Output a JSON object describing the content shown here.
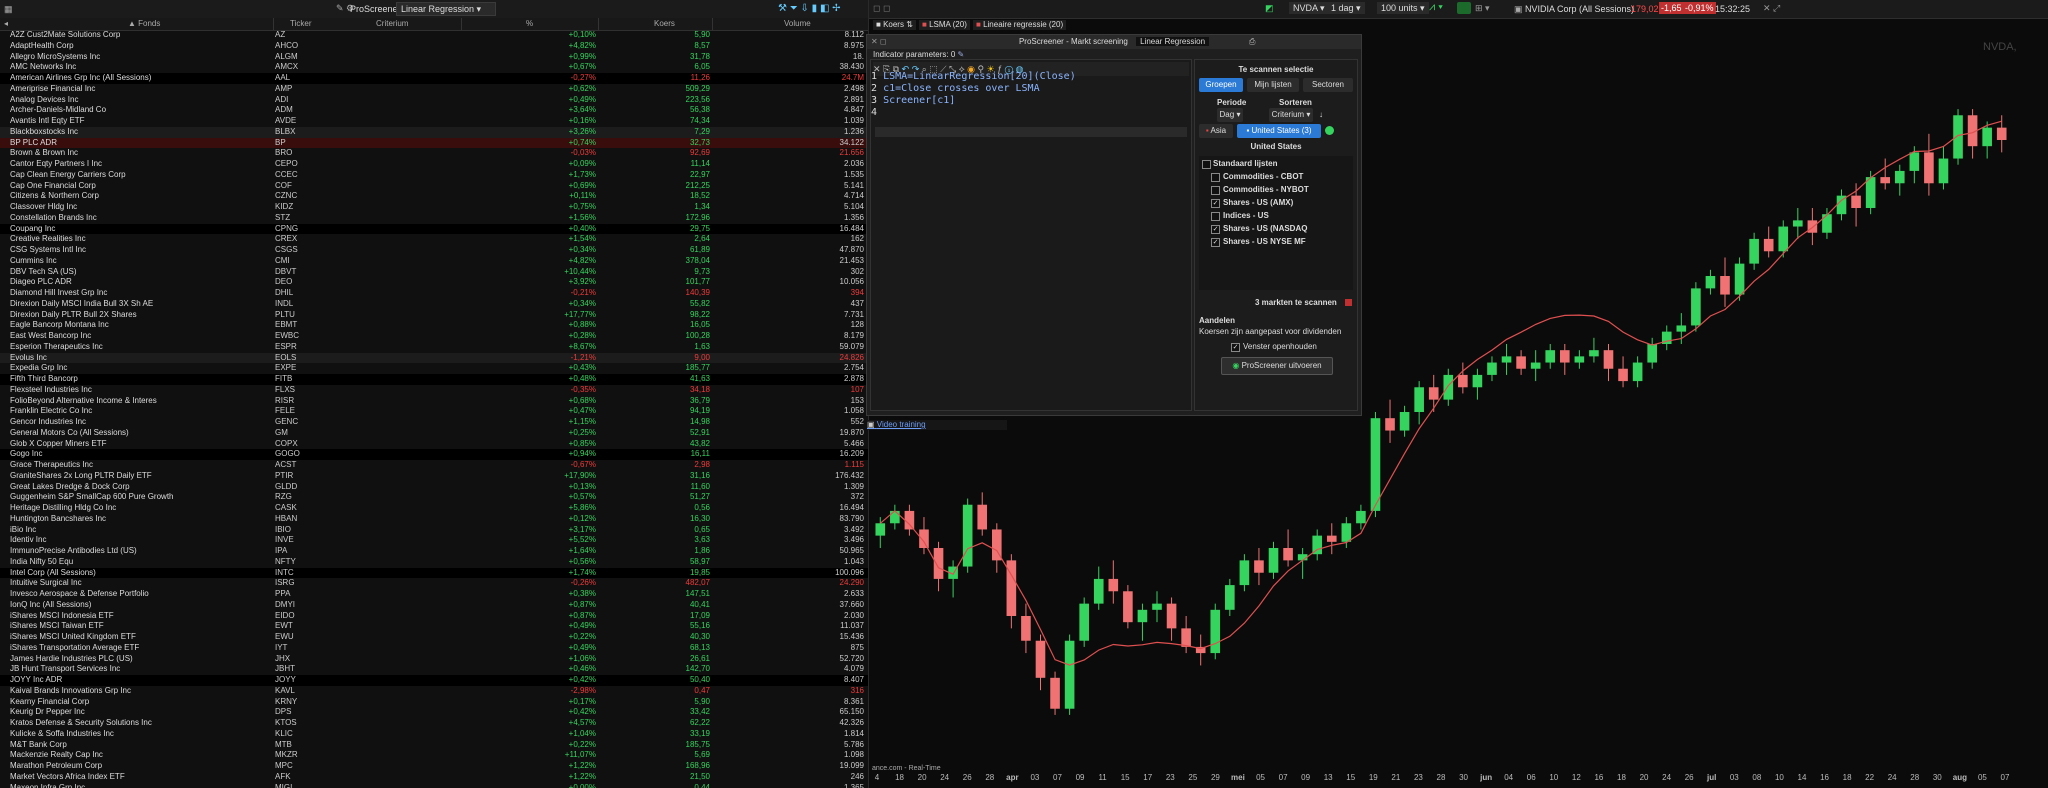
{
  "left_toolbar": {
    "title": "ProScreener",
    "dropdown": "Linear Regression"
  },
  "columns": {
    "name": "Fonds",
    "ticker": "Ticker",
    "criterium": "Criterium",
    "pct": "%",
    "price": "Koers",
    "volume": "Volume"
  },
  "rows": [
    {
      "name": "A2Z Cust2Mate Solutions Corp",
      "ticker": "AZ",
      "pct": "+0,10%",
      "price": "5,90",
      "vol": "8.112",
      "bg": ""
    },
    {
      "name": "AdaptHealth Corp",
      "ticker": "AHCO",
      "pct": "+4,82%",
      "price": "8,57",
      "vol": "8.975",
      "bg": ""
    },
    {
      "name": "Allegro MicroSystems Inc",
      "ticker": "ALGM",
      "pct": "+0,99%",
      "price": "31,78",
      "vol": "18.",
      "bg": ""
    },
    {
      "name": "AMC Networks Inc",
      "ticker": "AMCX",
      "pct": "+0,67%",
      "price": "6,05",
      "vol": "38.430",
      "bg": ""
    },
    {
      "name": "American Airlines Grp Inc (All Sessions)",
      "ticker": "AAL",
      "pct": "-0,27%",
      "price": "11,26",
      "vol": "24.7M",
      "bg": "black"
    },
    {
      "name": "Ameriprise Financial Inc",
      "ticker": "AMP",
      "pct": "+0,62%",
      "price": "509,29",
      "vol": "2.498",
      "bg": ""
    },
    {
      "name": "Analog Devices Inc",
      "ticker": "ADI",
      "pct": "+0,49%",
      "price": "223,56",
      "vol": "2.891",
      "bg": ""
    },
    {
      "name": "Archer-Daniels-Midland Co",
      "ticker": "ADM",
      "pct": "+3,64%",
      "price": "56,38",
      "vol": "4.847",
      "bg": ""
    },
    {
      "name": "Avantis Intl Eqty ETF",
      "ticker": "AVDE",
      "pct": "+0,16%",
      "price": "74,34",
      "vol": "1.039",
      "bg": ""
    },
    {
      "name": "Blackboxstocks Inc",
      "ticker": "BLBX",
      "pct": "+3,26%",
      "price": "7,29",
      "vol": "1.236",
      "bg": "dark"
    },
    {
      "name": "BP PLC ADR",
      "ticker": "BP",
      "pct": "+0,74%",
      "price": "32,73",
      "vol": "34.122",
      "bg": "red"
    },
    {
      "name": "Brown & Brown Inc",
      "ticker": "BRO",
      "pct": "-0,03%",
      "price": "92,69",
      "vol": "21.656",
      "bg": ""
    },
    {
      "name": "Cantor Eqty Partners I Inc",
      "ticker": "CEPO",
      "pct": "+0,09%",
      "price": "11,14",
      "vol": "2.036",
      "bg": ""
    },
    {
      "name": "Cap Clean Energy Carriers Corp",
      "ticker": "CCEC",
      "pct": "+1,73%",
      "price": "22,97",
      "vol": "1.535",
      "bg": ""
    },
    {
      "name": "Cap One Financial Corp",
      "ticker": "COF",
      "pct": "+0,69%",
      "price": "212,25",
      "vol": "5.141",
      "bg": ""
    },
    {
      "name": "Citizens & Northern Corp",
      "ticker": "CZNC",
      "pct": "+0,11%",
      "price": "18,52",
      "vol": "4.714",
      "bg": ""
    },
    {
      "name": "Classover Hldg Inc",
      "ticker": "KIDZ",
      "pct": "+0,75%",
      "price": "1,34",
      "vol": "5.104",
      "bg": ""
    },
    {
      "name": "Constellation Brands Inc",
      "ticker": "STZ",
      "pct": "+1,56%",
      "price": "172,96",
      "vol": "1.356",
      "bg": ""
    },
    {
      "name": "Coupang Inc",
      "ticker": "CPNG",
      "pct": "+0,40%",
      "price": "29,75",
      "vol": "16.484",
      "bg": "black"
    },
    {
      "name": "Creative Realities Inc",
      "ticker": "CREX",
      "pct": "+1,54%",
      "price": "2,64",
      "vol": "162",
      "bg": ""
    },
    {
      "name": "CSG Systems Intl Inc",
      "ticker": "CSGS",
      "pct": "+0,34%",
      "price": "61,89",
      "vol": "47.870",
      "bg": ""
    },
    {
      "name": "Cummins Inc",
      "ticker": "CMI",
      "pct": "+4,82%",
      "price": "378,04",
      "vol": "21.453",
      "bg": ""
    },
    {
      "name": "DBV Tech SA (US)",
      "ticker": "DBVT",
      "pct": "+10,44%",
      "price": "9,73",
      "vol": "302",
      "bg": ""
    },
    {
      "name": "Diageo PLC ADR",
      "ticker": "DEO",
      "pct": "+3,92%",
      "price": "101,77",
      "vol": "10.056",
      "bg": ""
    },
    {
      "name": "Diamond Hill Invest Grp Inc",
      "ticker": "DHIL",
      "pct": "-0,21%",
      "price": "140,39",
      "vol": "394",
      "bg": ""
    },
    {
      "name": "Direxion Daily MSCI India Bull 3X Sh AE",
      "ticker": "INDL",
      "pct": "+0,34%",
      "price": "55,82",
      "vol": "437",
      "bg": ""
    },
    {
      "name": "Direxion Daily PLTR Bull 2X Shares",
      "ticker": "PLTU",
      "pct": "+17,77%",
      "price": "98,22",
      "vol": "7.731",
      "bg": ""
    },
    {
      "name": "Eagle Bancorp Montana Inc",
      "ticker": "EBMT",
      "pct": "+0,88%",
      "price": "16,05",
      "vol": "128",
      "bg": ""
    },
    {
      "name": "East West Bancorp Inc",
      "ticker": "EWBC",
      "pct": "+0,28%",
      "price": "100,28",
      "vol": "8.179",
      "bg": ""
    },
    {
      "name": "Esperion Therapeutics Inc",
      "ticker": "ESPR",
      "pct": "+8,67%",
      "price": "1,63",
      "vol": "59.079",
      "bg": ""
    },
    {
      "name": "Evolus Inc",
      "ticker": "EOLS",
      "pct": "-1,21%",
      "price": "9,00",
      "vol": "24.826",
      "bg": "dark"
    },
    {
      "name": "Expedia Grp Inc",
      "ticker": "EXPE",
      "pct": "+0,43%",
      "price": "185,77",
      "vol": "2.754",
      "bg": ""
    },
    {
      "name": "Fifth Third Bancorp",
      "ticker": "FITB",
      "pct": "+0,48%",
      "price": "41,63",
      "vol": "2.878",
      "bg": "black"
    },
    {
      "name": "Flexsteel Industries Inc",
      "ticker": "FLXS",
      "pct": "-0,35%",
      "price": "34,18",
      "vol": "107",
      "bg": ""
    },
    {
      "name": "FolioBeyond Alternative Income & Interes",
      "ticker": "RISR",
      "pct": "+0,68%",
      "price": "36,79",
      "vol": "153",
      "bg": ""
    },
    {
      "name": "Franklin Electric Co Inc",
      "ticker": "FELE",
      "pct": "+0,47%",
      "price": "94,19",
      "vol": "1.058",
      "bg": ""
    },
    {
      "name": "Gencor Industries Inc",
      "ticker": "GENC",
      "pct": "+1,15%",
      "price": "14,98",
      "vol": "552",
      "bg": ""
    },
    {
      "name": "General Motors Co (All Sessions)",
      "ticker": "GM",
      "pct": "+0,25%",
      "price": "52,91",
      "vol": "19.870",
      "bg": ""
    },
    {
      "name": "Glob X Copper Miners ETF",
      "ticker": "COPX",
      "pct": "+0,85%",
      "price": "43,82",
      "vol": "5.466",
      "bg": ""
    },
    {
      "name": "Gogo Inc",
      "ticker": "GOGO",
      "pct": "+0,94%",
      "price": "16,11",
      "vol": "16.209",
      "bg": "black"
    },
    {
      "name": "Grace Therapeutics Inc",
      "ticker": "ACST",
      "pct": "-0,67%",
      "price": "2,98",
      "vol": "1.115",
      "bg": ""
    },
    {
      "name": "GraniteShares 2x Long PLTR Daily ETF",
      "ticker": "PTIR",
      "pct": "+17,90%",
      "price": "31,16",
      "vol": "176.432",
      "bg": ""
    },
    {
      "name": "Great Lakes Dredge & Dock Corp",
      "ticker": "GLDD",
      "pct": "+0,13%",
      "price": "11,60",
      "vol": "1.309",
      "bg": ""
    },
    {
      "name": "Guggenheim S&P SmallCap 600 Pure Growth",
      "ticker": "RZG",
      "pct": "+0,57%",
      "price": "51,27",
      "vol": "372",
      "bg": ""
    },
    {
      "name": "Heritage Distilling Hldg Co Inc",
      "ticker": "CASK",
      "pct": "+5,86%",
      "price": "0,56",
      "vol": "16.494",
      "bg": ""
    },
    {
      "name": "Huntington Bancshares Inc",
      "ticker": "HBAN",
      "pct": "+0,12%",
      "price": "16,30",
      "vol": "83.790",
      "bg": ""
    },
    {
      "name": "iBio Inc",
      "ticker": "IBIO",
      "pct": "+3,17%",
      "price": "0,65",
      "vol": "3.492",
      "bg": ""
    },
    {
      "name": "Identiv Inc",
      "ticker": "INVE",
      "pct": "+5,52%",
      "price": "3,63",
      "vol": "3.496",
      "bg": ""
    },
    {
      "name": "ImmunoPrecise Antibodies Ltd (US)",
      "ticker": "IPA",
      "pct": "+1,64%",
      "price": "1,86",
      "vol": "50.965",
      "bg": ""
    },
    {
      "name": "India Nifty 50 Equ",
      "ticker": "NFTY",
      "pct": "+0,56%",
      "price": "58,97",
      "vol": "1.043",
      "bg": ""
    },
    {
      "name": "Intel Corp (All Sessions)",
      "ticker": "INTC",
      "pct": "+1,74%",
      "price": "19,85",
      "vol": "100.096",
      "bg": "black"
    },
    {
      "name": "Intuitive Surgical Inc",
      "ticker": "ISRG",
      "pct": "-0,26%",
      "price": "482,07",
      "vol": "24.290",
      "bg": ""
    },
    {
      "name": "Invesco Aerospace & Defense Portfolio",
      "ticker": "PPA",
      "pct": "+0,38%",
      "price": "147,51",
      "vol": "2.633",
      "bg": ""
    },
    {
      "name": "IonQ Inc (All Sessions)",
      "ticker": "DMYI",
      "pct": "+0,87%",
      "price": "40,41",
      "vol": "37.660",
      "bg": ""
    },
    {
      "name": "iShares MSCI Indonesia ETF",
      "ticker": "EIDO",
      "pct": "+0,87%",
      "price": "17,09",
      "vol": "2.030",
      "bg": ""
    },
    {
      "name": "iShares MSCI Taiwan ETF",
      "ticker": "EWT",
      "pct": "+0,49%",
      "price": "55,16",
      "vol": "11.037",
      "bg": ""
    },
    {
      "name": "iShares MSCI United Kingdom ETF",
      "ticker": "EWU",
      "pct": "+0,22%",
      "price": "40,30",
      "vol": "15.436",
      "bg": ""
    },
    {
      "name": "iShares Transportation Average ETF",
      "ticker": "IYT",
      "pct": "+0,49%",
      "price": "68,13",
      "vol": "875",
      "bg": ""
    },
    {
      "name": "James Hardie Industries PLC (US)",
      "ticker": "JHX",
      "pct": "+1,06%",
      "price": "26,61",
      "vol": "52.720",
      "bg": ""
    },
    {
      "name": "JB Hunt Transport Services Inc",
      "ticker": "JBHT",
      "pct": "+0,46%",
      "price": "142,70",
      "vol": "4.079",
      "bg": ""
    },
    {
      "name": "JOYY Inc ADR",
      "ticker": "JOYY",
      "pct": "+0,42%",
      "price": "50,40",
      "vol": "8.407",
      "bg": "black"
    },
    {
      "name": "Kaival Brands Innovations Grp Inc",
      "ticker": "KAVL",
      "pct": "-2,98%",
      "price": "0,47",
      "vol": "316",
      "bg": ""
    },
    {
      "name": "Kearny Financial Corp",
      "ticker": "KRNY",
      "pct": "+0,17%",
      "price": "5,90",
      "vol": "8.361",
      "bg": ""
    },
    {
      "name": "Keurig Dr Pepper Inc",
      "ticker": "DPS",
      "pct": "+0,42%",
      "price": "33,42",
      "vol": "65.150",
      "bg": ""
    },
    {
      "name": "Kratos Defense & Security Solutions Inc",
      "ticker": "KTOS",
      "pct": "+4,57%",
      "price": "62,22",
      "vol": "42.326",
      "bg": ""
    },
    {
      "name": "Kulicke & Soffa Industries Inc",
      "ticker": "KLIC",
      "pct": "+1,04%",
      "price": "33,19",
      "vol": "1.814",
      "bg": ""
    },
    {
      "name": "M&T Bank Corp",
      "ticker": "MTB",
      "pct": "+0,22%",
      "price": "185,75",
      "vol": "5.786",
      "bg": ""
    },
    {
      "name": "Mackenzie Realty Cap Inc",
      "ticker": "MKZR",
      "pct": "+11,07%",
      "price": "5,69",
      "vol": "1.098",
      "bg": ""
    },
    {
      "name": "Marathon Petroleum Corp",
      "ticker": "MPC",
      "pct": "+1,22%",
      "price": "168,96",
      "vol": "19.099",
      "bg": ""
    },
    {
      "name": "Market Vectors Africa Index ETF",
      "ticker": "AFK",
      "pct": "+1,22%",
      "price": "21,50",
      "vol": "246",
      "bg": ""
    },
    {
      "name": "Maxeon Infra Grn Inc",
      "ticker": "MIGI",
      "pct": "+0,00%",
      "price": "0,44",
      "vol": "1.365",
      "bg": ""
    }
  ],
  "right_toolbar": {
    "symbol": "NVDA",
    "period": "1 dag",
    "units": "100 units",
    "instrument": "NVIDIA Corp (All Sessions)",
    "last": "179,02",
    "change": "-1,65",
    "change_pct": "-0,91%",
    "time": "15:32:25"
  },
  "tabs": [
    "Koers",
    "LSMA (20)",
    "Lineaire regressie (20)"
  ],
  "chart_label": "NVDA, D",
  "dialog": {
    "title": "ProScreener - Markt screening",
    "subtitle": "Linear Regression",
    "indicator_params": "Indicator parameters: 0",
    "code_lines": [
      {
        "n": "1",
        "text": "LSMA=LinearRegression[20](Close)"
      },
      {
        "n": "2",
        "text": "c1=Close crosses over LSMA"
      },
      {
        "n": "3",
        "text": "Screener[c1]"
      },
      {
        "n": "4",
        "text": ""
      }
    ],
    "video_link": "Video training",
    "sel_title": "Te scannen selectie",
    "tab_groups": "Groepen",
    "tab_lists": "Mijn lijsten",
    "tab_sectors": "Sectoren",
    "period_label": "Periode",
    "sort_label": "Sorteren",
    "period_value": "Dag",
    "sort_value": "Criterium",
    "region_asia": "Asia",
    "region_us": "United States (3)",
    "region_header": "United States",
    "standard_lists": "Standaard lijsten",
    "markets": [
      {
        "label": "Commodities - CBOT",
        "checked": false
      },
      {
        "label": "Commodities - NYBOT",
        "checked": false
      },
      {
        "label": "Shares - US (AMX)",
        "checked": true
      },
      {
        "label": "Indices - US",
        "checked": false
      },
      {
        "label": "Shares - US (NASDAQ",
        "checked": true
      },
      {
        "label": "Shares - US NYSE MF",
        "checked": true
      }
    ],
    "markets_count": "3 markten te scannen",
    "shares_title": "Aandelen",
    "shares_note": "Koersen zijn aangepast voor dividenden",
    "keep_open": "Venster openhouden",
    "run_button": "ProScreener uitvoeren"
  },
  "x_axis_labels": [
    "4",
    "18",
    "20",
    "24",
    "26",
    "28",
    "apr",
    "03",
    "07",
    "09",
    "11",
    "15",
    "17",
    "23",
    "25",
    "29",
    "mei",
    "05",
    "07",
    "09",
    "13",
    "15",
    "19",
    "21",
    "23",
    "28",
    "30",
    "jun",
    "04",
    "06",
    "10",
    "12",
    "16",
    "18",
    "20",
    "24",
    "26",
    "jul",
    "03",
    "08",
    "10",
    "14",
    "16",
    "18",
    "22",
    "24",
    "28",
    "30",
    "aug",
    "05",
    "07"
  ],
  "footer_source": "ance.com - Real-Time",
  "colors": {
    "up": "#35d45f",
    "down": "#f07272",
    "lsma": "#e05050"
  },
  "chart_data": {
    "type": "candlestick",
    "title": "NVDA, D",
    "series": [
      {
        "name": "LSMA (20)",
        "type": "line"
      }
    ],
    "ohlc": [
      [
        115,
        118,
        113,
        117
      ],
      [
        117,
        120,
        116,
        119
      ],
      [
        119,
        120,
        115,
        116
      ],
      [
        116,
        118,
        112,
        113
      ],
      [
        113,
        114,
        106,
        108
      ],
      [
        108,
        111,
        105,
        110
      ],
      [
        110,
        121,
        109,
        120
      ],
      [
        120,
        122,
        115,
        116
      ],
      [
        116,
        117,
        109,
        111
      ],
      [
        111,
        112,
        100,
        102
      ],
      [
        102,
        104,
        96,
        98
      ],
      [
        98,
        99,
        90,
        92
      ],
      [
        92,
        93,
        86,
        87
      ],
      [
        87,
        99,
        86,
        98
      ],
      [
        98,
        105,
        97,
        104
      ],
      [
        104,
        110,
        103,
        108
      ],
      [
        108,
        111,
        104,
        106
      ],
      [
        106,
        107,
        100,
        101
      ],
      [
        101,
        104,
        98,
        103
      ],
      [
        103,
        106,
        101,
        104
      ],
      [
        104,
        105,
        98,
        100
      ],
      [
        100,
        102,
        96,
        97
      ],
      [
        97,
        99,
        94,
        96
      ],
      [
        96,
        104,
        95,
        103
      ],
      [
        103,
        108,
        102,
        107
      ],
      [
        107,
        112,
        106,
        111
      ],
      [
        111,
        113,
        107,
        109
      ],
      [
        109,
        114,
        108,
        113
      ],
      [
        113,
        116,
        110,
        111
      ],
      [
        111,
        113,
        108,
        112
      ],
      [
        112,
        116,
        111,
        115
      ],
      [
        115,
        117,
        112,
        114
      ],
      [
        114,
        118,
        113,
        117
      ],
      [
        117,
        120,
        116,
        119
      ],
      [
        119,
        135,
        118,
        134
      ],
      [
        134,
        137,
        130,
        132
      ],
      [
        132,
        136,
        131,
        135
      ],
      [
        135,
        140,
        133,
        139
      ],
      [
        139,
        141,
        135,
        137
      ],
      [
        137,
        142,
        136,
        141
      ],
      [
        141,
        143,
        138,
        139
      ],
      [
        139,
        142,
        137,
        141
      ],
      [
        141,
        144,
        140,
        143
      ],
      [
        143,
        146,
        141,
        144
      ],
      [
        144,
        145,
        141,
        142
      ],
      [
        142,
        145,
        140,
        143
      ],
      [
        143,
        146,
        142,
        145
      ],
      [
        145,
        146,
        141,
        143
      ],
      [
        143,
        145,
        142,
        144
      ],
      [
        144,
        147,
        143,
        145
      ],
      [
        145,
        146,
        140,
        142
      ],
      [
        142,
        144,
        139,
        140
      ],
      [
        140,
        144,
        139,
        143
      ],
      [
        143,
        147,
        142,
        146
      ],
      [
        146,
        149,
        145,
        148
      ],
      [
        148,
        151,
        146,
        149
      ],
      [
        149,
        156,
        148,
        155
      ],
      [
        155,
        158,
        154,
        157
      ],
      [
        157,
        160,
        152,
        154
      ],
      [
        154,
        160,
        153,
        159
      ],
      [
        159,
        164,
        158,
        163
      ],
      [
        163,
        165,
        160,
        161
      ],
      [
        161,
        166,
        160,
        165
      ],
      [
        165,
        168,
        163,
        166
      ],
      [
        166,
        168,
        162,
        164
      ],
      [
        164,
        168,
        163,
        167
      ],
      [
        167,
        171,
        166,
        170
      ],
      [
        170,
        172,
        165,
        168
      ],
      [
        168,
        174,
        167,
        173
      ],
      [
        173,
        176,
        171,
        172
      ],
      [
        172,
        175,
        170,
        174
      ],
      [
        174,
        178,
        172,
        177
      ],
      [
        177,
        180,
        170,
        172
      ],
      [
        172,
        178,
        171,
        176
      ],
      [
        176,
        184,
        175,
        183
      ],
      [
        183,
        184,
        176,
        178
      ],
      [
        178,
        182,
        176,
        181
      ],
      [
        181,
        183,
        177,
        179
      ]
    ]
  }
}
